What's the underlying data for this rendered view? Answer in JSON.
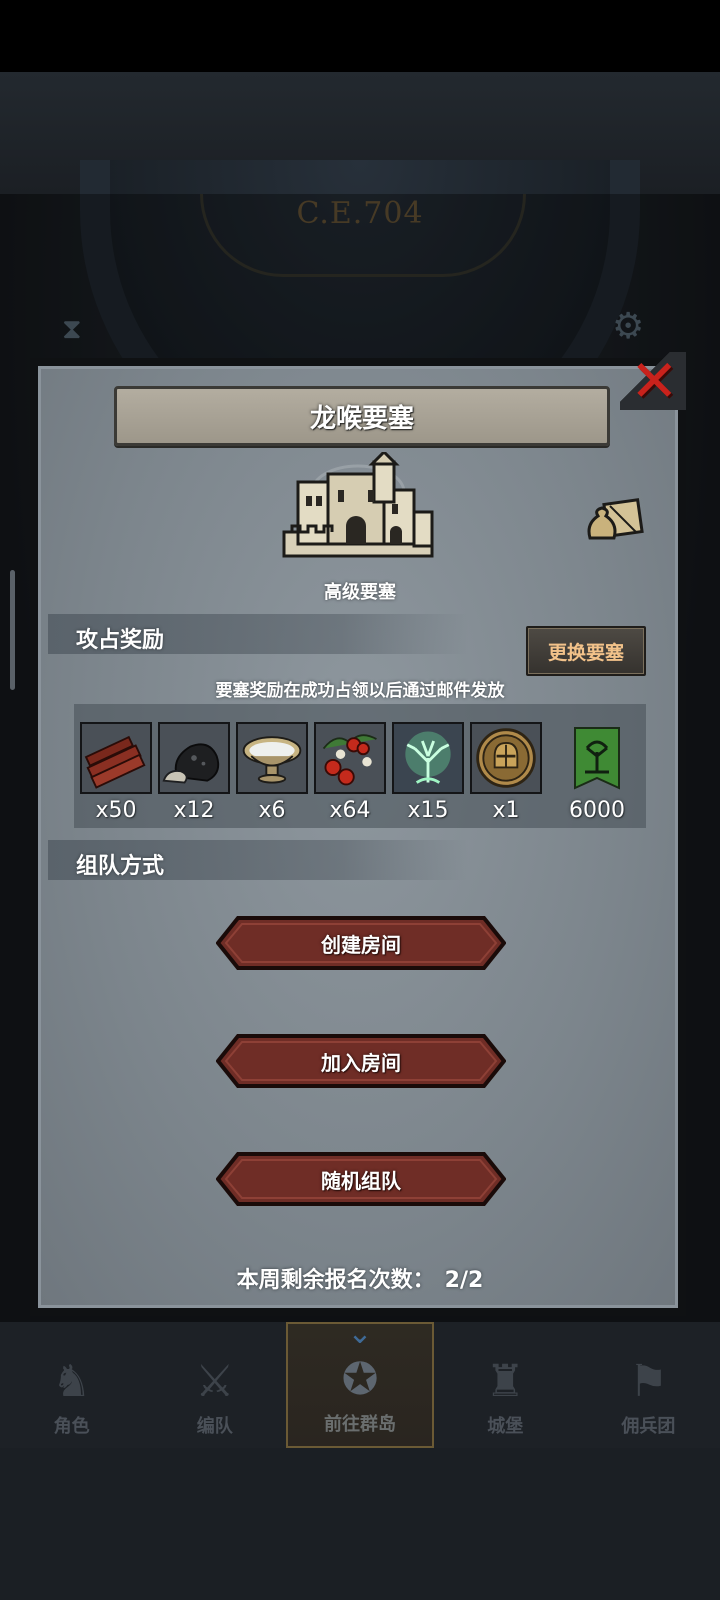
{
  "background": {
    "era_label": "C.E.704"
  },
  "dialog": {
    "title": "龙喉要塞",
    "fortress_type": "高级要塞",
    "rewards_section": {
      "heading": "攻占奖励",
      "swap_button": "更换要塞",
      "notice": "要塞奖励在成功占领以后通过邮件发放",
      "items": [
        {
          "icon": "wood-logs-icon",
          "qty": "x50"
        },
        {
          "icon": "ore-rock-icon",
          "qty": "x12"
        },
        {
          "icon": "bowl-icon",
          "qty": "x6"
        },
        {
          "icon": "berries-icon",
          "qty": "x64"
        },
        {
          "icon": "spirit-tree-icon",
          "qty": "x15"
        },
        {
          "icon": "knight-helmet-coin-icon",
          "qty": "x1"
        },
        {
          "icon": "tree-banner-icon",
          "qty": "6000"
        }
      ]
    },
    "team_section": {
      "heading": "组队方式",
      "buttons": [
        "创建房间",
        "加入房间",
        "随机组队"
      ]
    },
    "signups": {
      "label": "本周剩余报名次数：",
      "value": "2/2"
    }
  },
  "bottom_nav": {
    "items": [
      {
        "label": "角色",
        "icon": "knight-icon"
      },
      {
        "label": "编队",
        "icon": "formation-icon"
      },
      {
        "label": "前往群岛",
        "icon": "compass-map-icon"
      },
      {
        "label": "城堡",
        "icon": "castle-icon"
      },
      {
        "label": "佣兵团",
        "icon": "mercenary-icon"
      }
    ],
    "active_index": 2
  },
  "colors": {
    "accent_button": "#6f2d26",
    "swap_text": "#f2c28a",
    "close_red": "#c9221c"
  }
}
